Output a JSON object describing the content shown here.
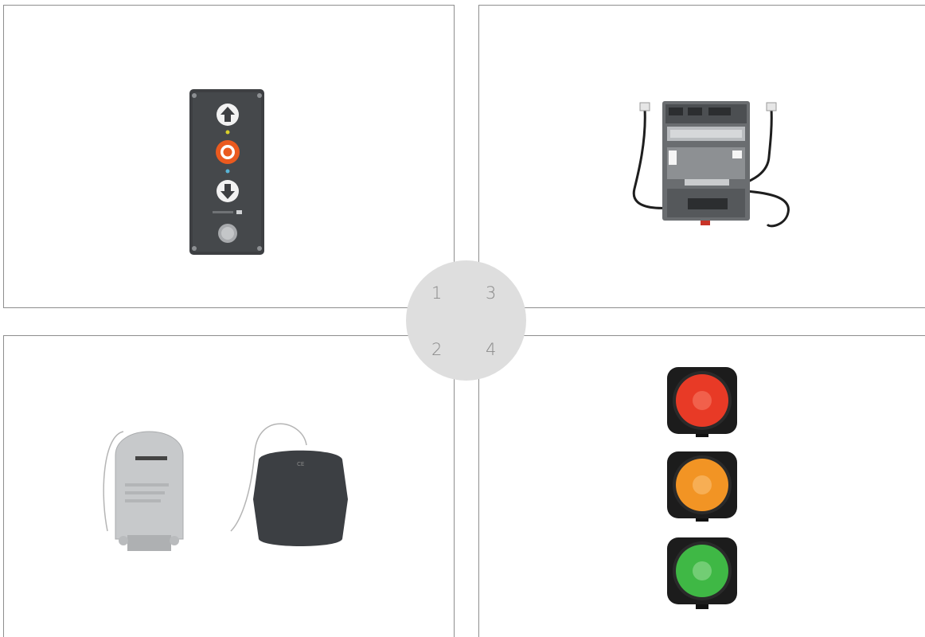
{
  "panels": [
    {
      "number": "1",
      "product": "wall-push-button-panel"
    },
    {
      "number": "2",
      "product": "radio-receivers"
    },
    {
      "number": "3",
      "product": "relay-module"
    },
    {
      "number": "4",
      "product": "traffic-lights"
    }
  ],
  "colors": {
    "border": "#8e8e8e",
    "disc": "#dedede",
    "number": "#8a8a8a",
    "light_red": "#e83a26",
    "light_amber": "#f29424",
    "light_green": "#3fb845"
  }
}
